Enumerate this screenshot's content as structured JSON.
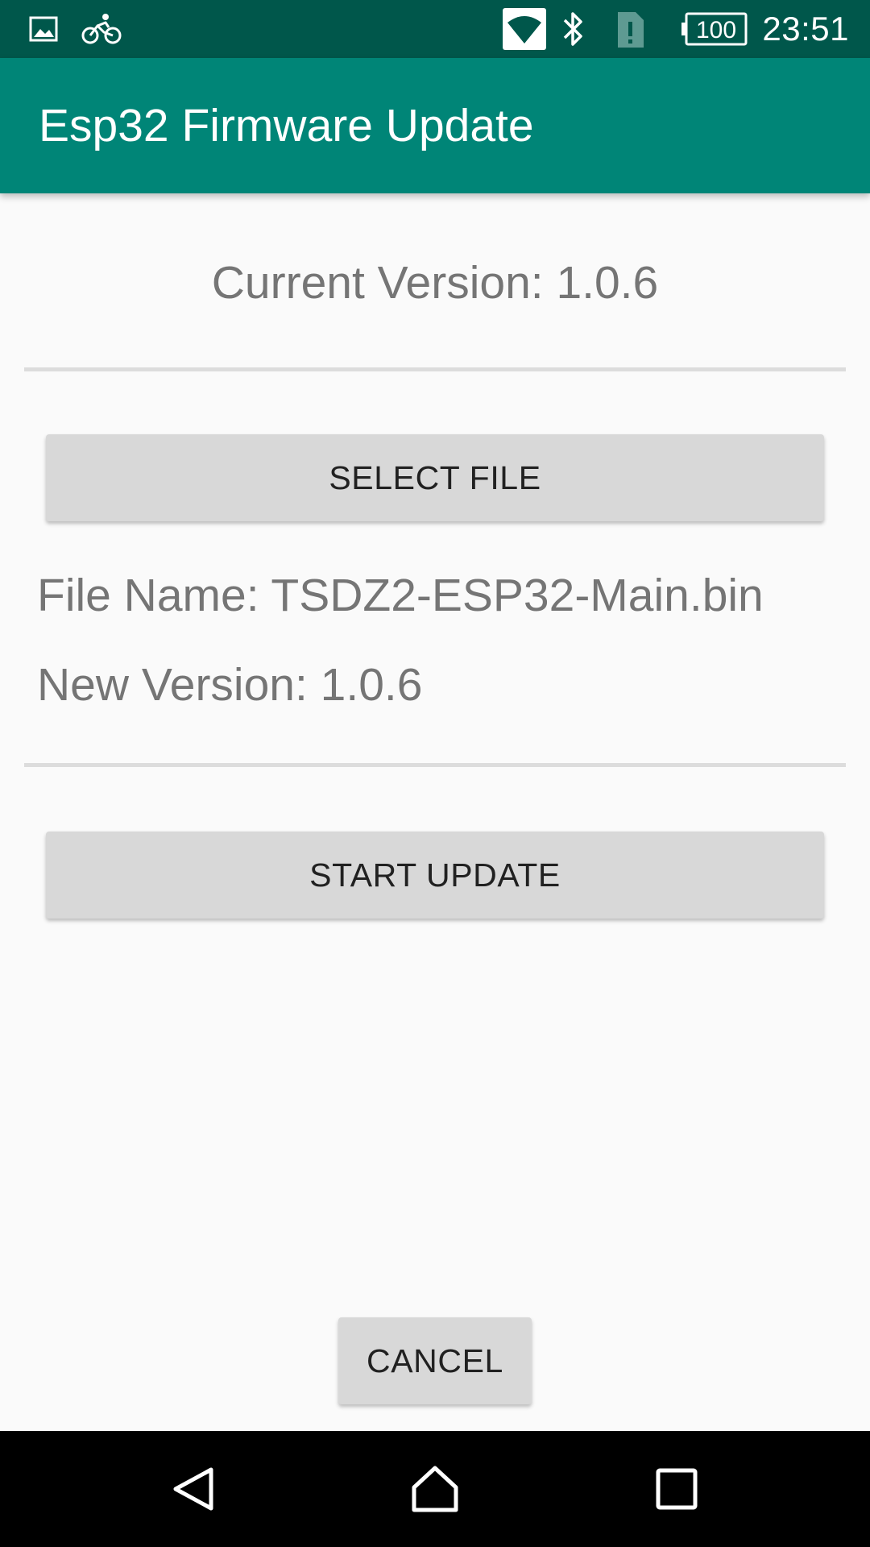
{
  "status_bar": {
    "icons": [
      "image-icon",
      "bicycle-icon",
      "wifi-icon",
      "bluetooth-icon",
      "sim-alert-icon",
      "battery-icon"
    ],
    "battery_level": "100",
    "time": "23:51"
  },
  "app_bar": {
    "title": "Esp32 Firmware Update"
  },
  "main": {
    "current_version": "Current Version: 1.0.6",
    "select_file_label": "SELECT FILE",
    "file_name": "File Name: TSDZ2-ESP32-Main.bin",
    "new_version": "New Version: 1.0.6",
    "start_update_label": "START UPDATE",
    "cancel_label": "CANCEL"
  },
  "nav_bar": {
    "icons": [
      "back-icon",
      "home-icon",
      "recents-icon"
    ]
  },
  "colors": {
    "status_bar": "#00574B",
    "app_bar": "#008577",
    "background": "#FAFAFA",
    "button": "#D8D8D8",
    "secondary_text": "#757575"
  }
}
